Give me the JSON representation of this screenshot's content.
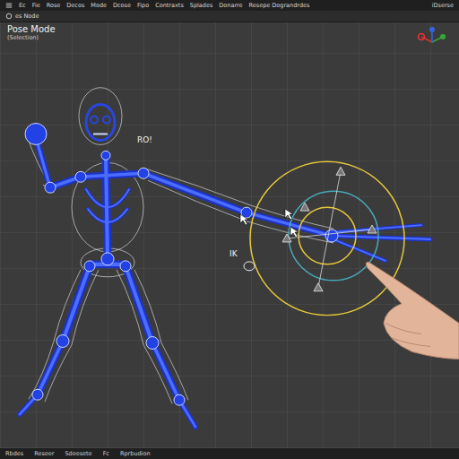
{
  "menu": [
    "Ec",
    "Fie",
    "Rose",
    "Decos",
    "Mode",
    "Dcose",
    "Fipo",
    "Contraxts",
    "Splades",
    "Donarre",
    "Resepe Dograndrdes"
  ],
  "menu_right": "iDserse",
  "header": {
    "mode_selector": "es Node"
  },
  "viewport": {
    "title": "Pose Mode",
    "subtitle": "(Selection)",
    "head_label": "RO!",
    "ik_label": "IK"
  },
  "status_bar": [
    "Rbdes",
    "Reseer",
    "Sdeesete",
    "Fc",
    "Rprbudion"
  ]
}
